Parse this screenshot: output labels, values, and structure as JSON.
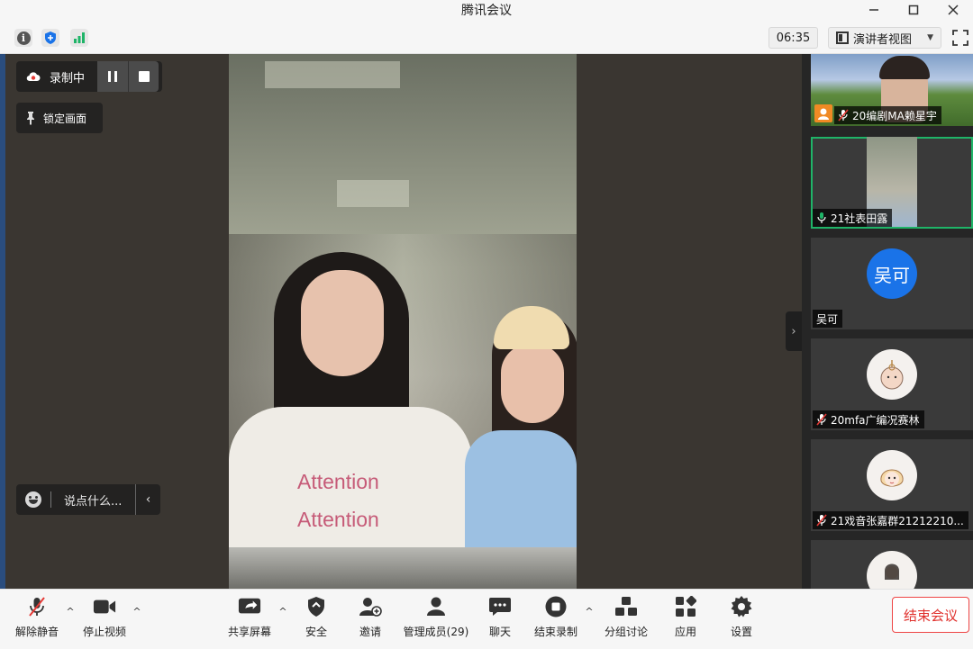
{
  "window": {
    "title": "腾讯会议",
    "controls": [
      "minimize",
      "maximize",
      "close"
    ]
  },
  "topbar": {
    "icons": [
      "info-icon",
      "shield-icon",
      "signal-icon"
    ],
    "timer": "06:35",
    "view_mode": "演讲者视图",
    "accent_color": "#1fb468"
  },
  "recording": {
    "status": "录制中"
  },
  "lock_screen": {
    "label": "锁定画面"
  },
  "chat": {
    "placeholder": "说点什么..."
  },
  "main_video": {
    "shirt_text": [
      "Attention",
      "Attention"
    ]
  },
  "gallery": {
    "tiles": [
      {
        "name": "20编剧MA赖星宇",
        "mic": "muted"
      },
      {
        "name": "21社表田露",
        "mic": "active"
      },
      {
        "name": "吴可",
        "avatar_text": "吴可",
        "mic": "none"
      },
      {
        "name": "20mfa广编况赛林",
        "mic": "muted"
      },
      {
        "name": "21戏音张嘉群21212210...",
        "mic": "muted"
      }
    ]
  },
  "toolbar": {
    "unmute": "解除静音",
    "stop_video": "停止视频",
    "share_screen": "共享屏幕",
    "security": "安全",
    "invite": "邀请",
    "manage_members": "管理成员(29)",
    "chat": "聊天",
    "end_recording": "结束录制",
    "breakout": "分组讨论",
    "apps": "应用",
    "settings": "设置",
    "end_meeting": "结束会议"
  }
}
